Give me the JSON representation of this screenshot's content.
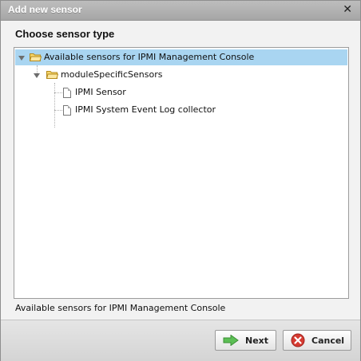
{
  "dialog": {
    "title": "Add new sensor",
    "heading": "Choose sensor type",
    "close_icon": "close-icon"
  },
  "tree": {
    "root": {
      "label": "Available sensors for IPMI Management Console",
      "expanded": true,
      "selected": true
    },
    "group": {
      "label": "moduleSpecificSensors",
      "expanded": true
    },
    "items": [
      {
        "label": "IPMI Sensor"
      },
      {
        "label": "IPMI System Event Log collector"
      }
    ]
  },
  "status_text": "Available sensors for IPMI Management Console",
  "buttons": {
    "next_label": "Next",
    "cancel_label": "Cancel"
  },
  "colors": {
    "selection": "#a9d5f1",
    "folder": "#f2c94c",
    "next_arrow": "#4caf50",
    "cancel_red": "#d0312d"
  }
}
